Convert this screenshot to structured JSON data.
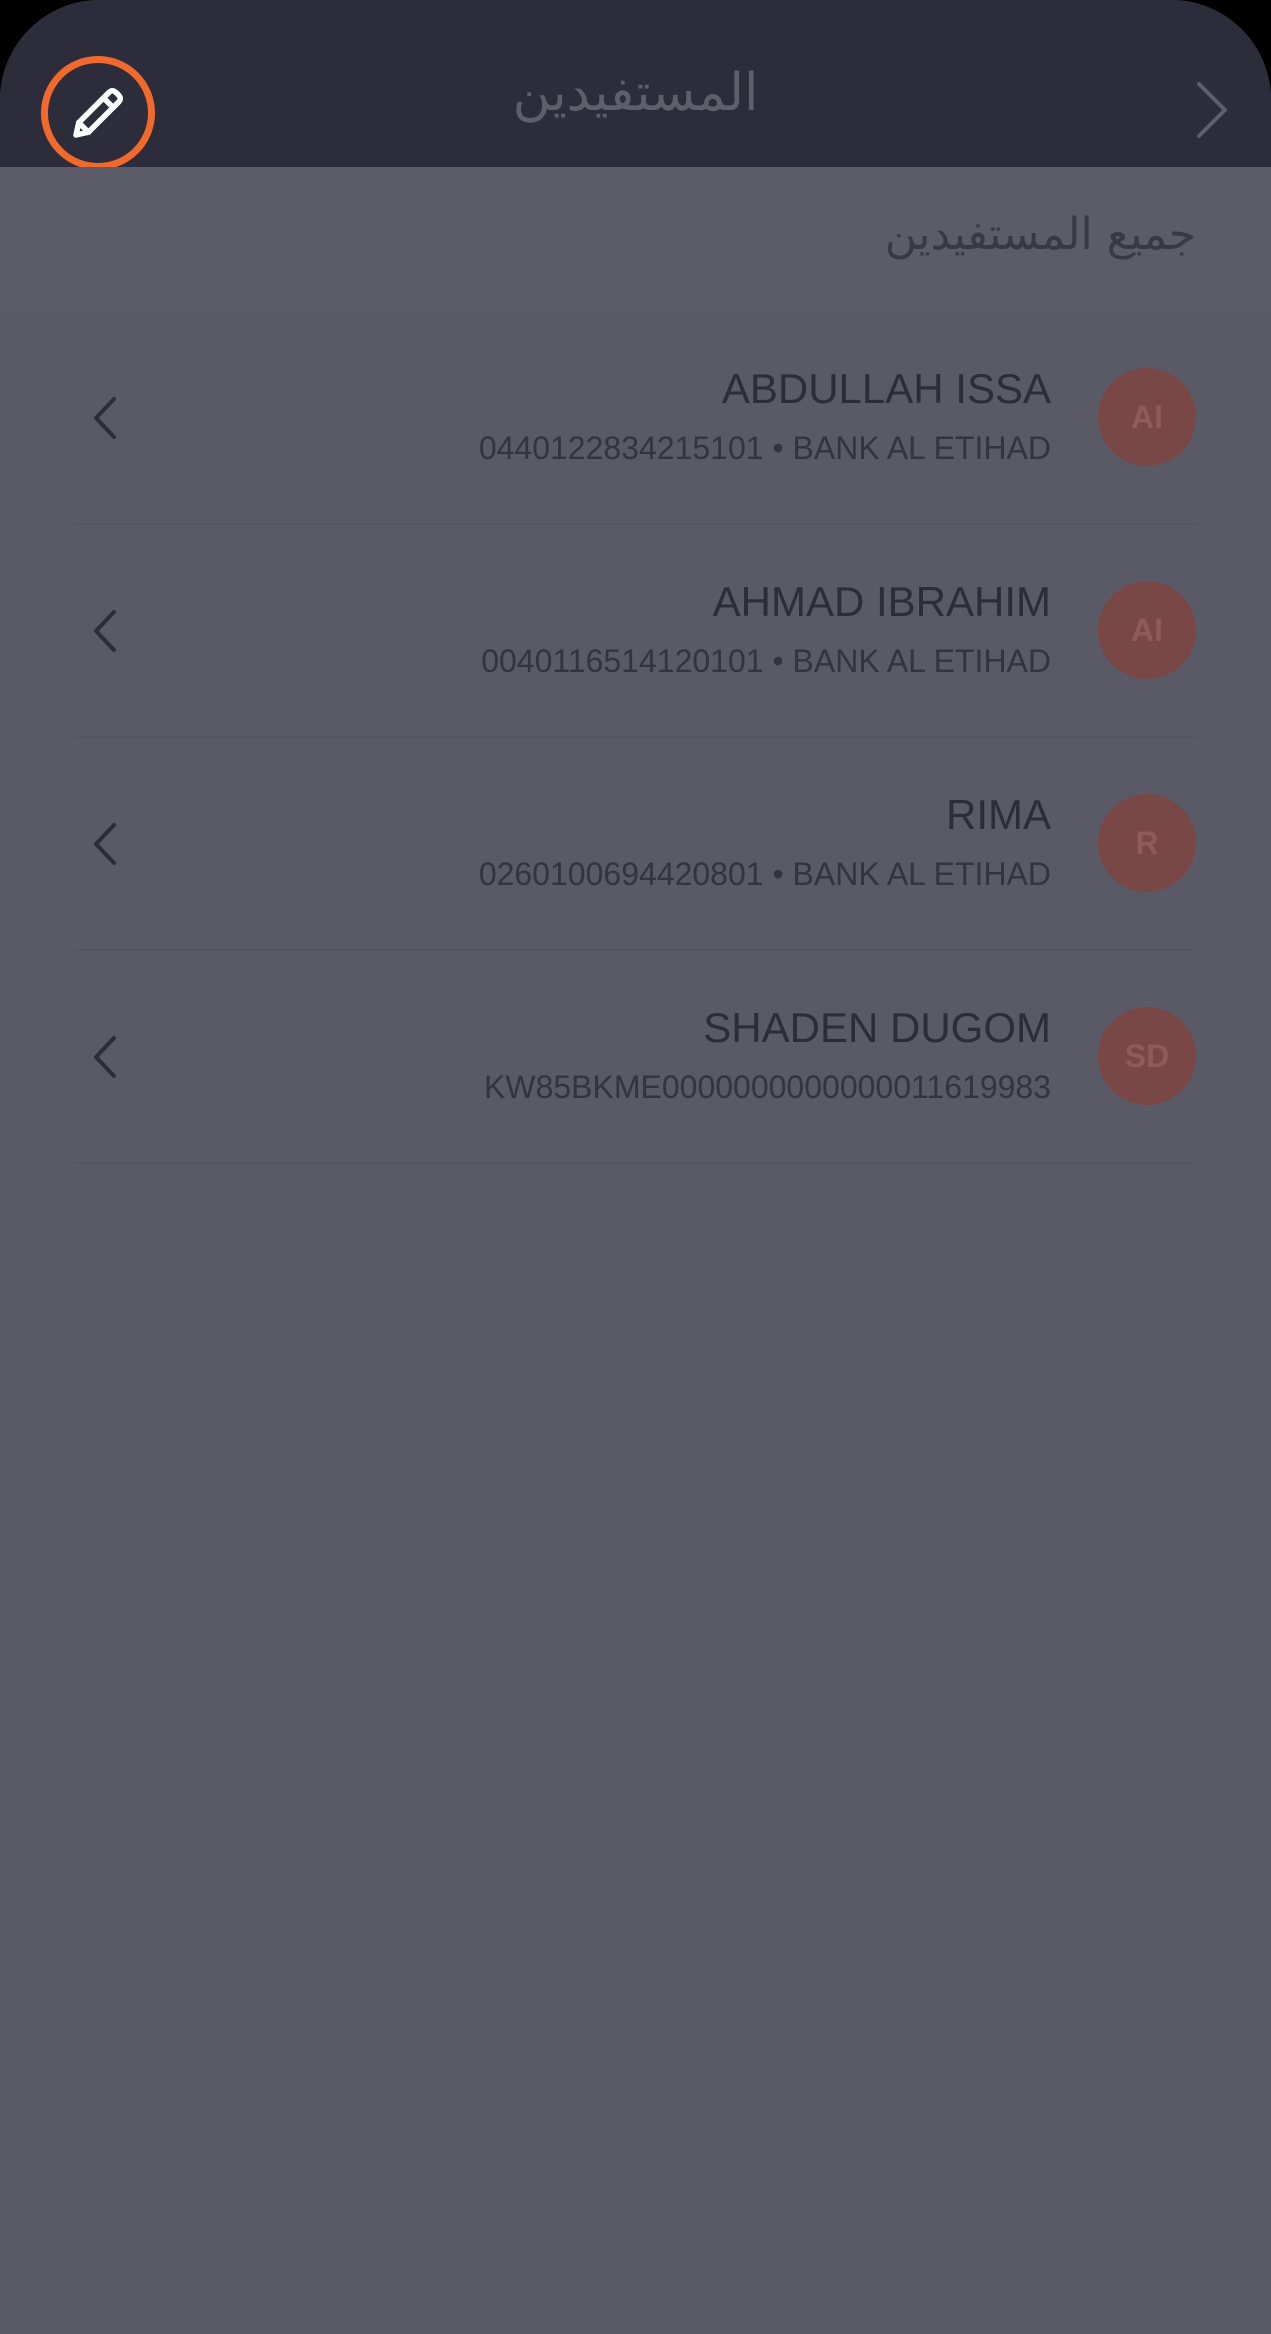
{
  "header": {
    "title": "المستفيدين",
    "edit_icon": "pencil-icon",
    "back_icon": "chevron-right-icon"
  },
  "section": {
    "title": "جميع المستفيدين"
  },
  "beneficiaries": [
    {
      "initials": "AI",
      "name": "ABDULLAH ISSA",
      "details": "0440122834215101 • BANK AL ETIHAD"
    },
    {
      "initials": "AI",
      "name": "AHMAD IBRAHIM",
      "details": "0040116514120101 • BANK AL ETIHAD"
    },
    {
      "initials": "R",
      "name": "RIMA",
      "details": "0260100694420801 • BANK AL ETIHAD"
    },
    {
      "initials": "SD",
      "name": "SHADEN DUGOM",
      "details": "KW85BKME0000000000000011619983"
    }
  ],
  "colors": {
    "header_bg": "#2c2c3a",
    "page_bg": "#5a5a66",
    "accent": "#f0692d",
    "avatar_bg": "#7a4747"
  }
}
